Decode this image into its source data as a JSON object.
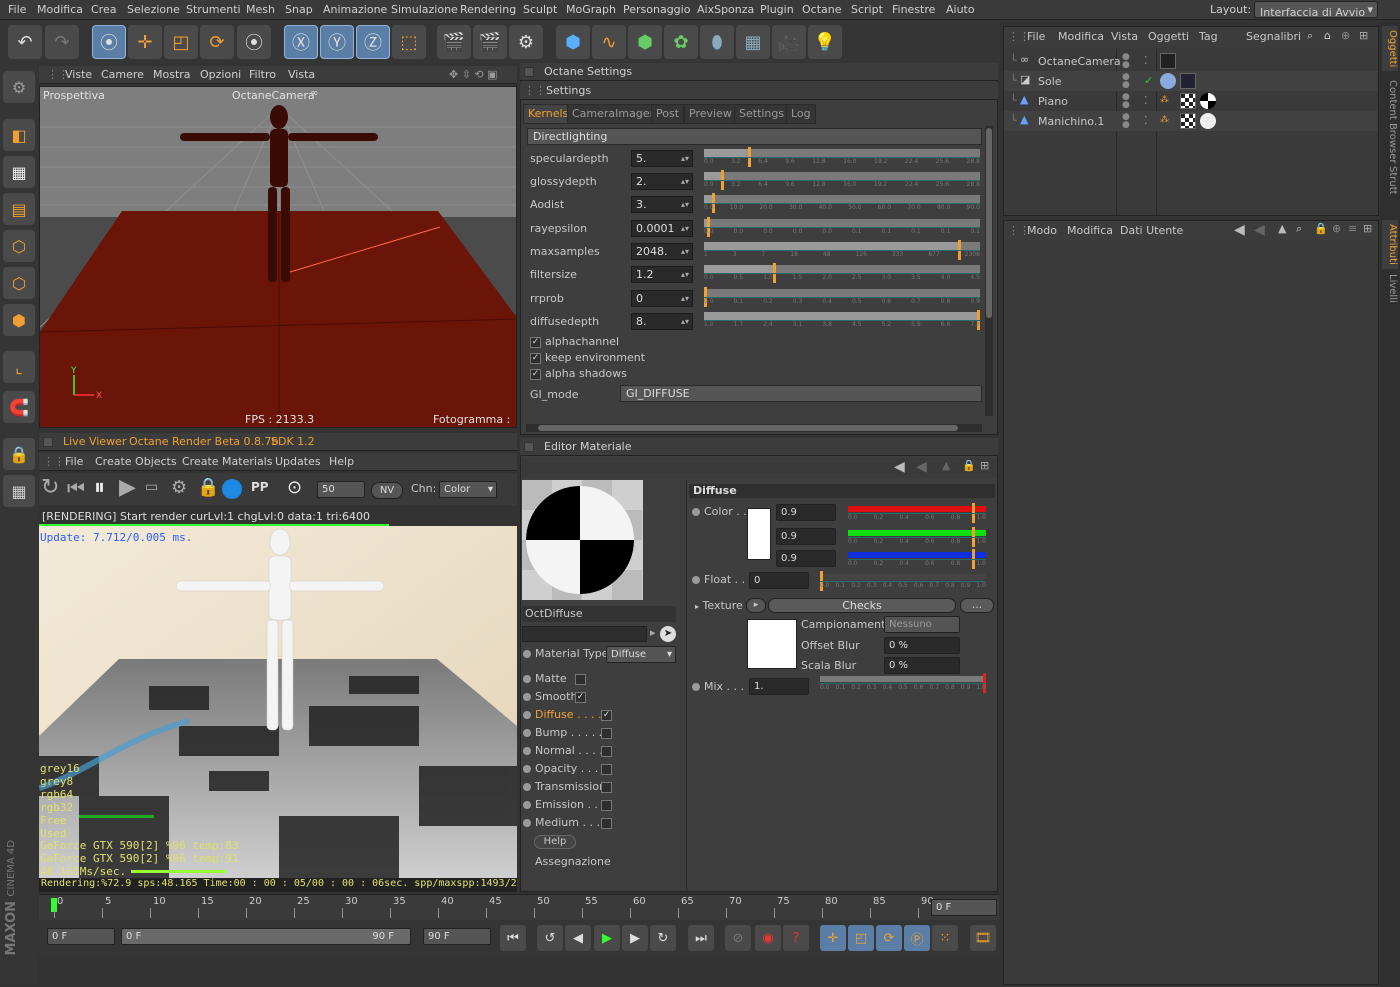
{
  "menu": [
    "File",
    "Modifica",
    "Crea",
    "Selezione",
    "Strumenti",
    "Mesh",
    "Snap",
    "Animazione",
    "Simulazione",
    "Rendering",
    "Sculpt",
    "MoGraph",
    "Personaggio",
    "AixSponza",
    "Plugin",
    "Octane",
    "Script",
    "Finestre",
    "Aiuto"
  ],
  "layout": {
    "label": "Layout:",
    "value": "Interfaccia di Avvio"
  },
  "viewport": {
    "menu": [
      "Viste",
      "Camere",
      "Mostra",
      "Opzioni",
      "Filtro",
      "Vista"
    ],
    "name": "Prospettiva",
    "camera": "OctaneCamera",
    "fps": "FPS : 2133.3",
    "frame": "Fotogramma : 0",
    "axis_y": "Y",
    "axis_x": "X"
  },
  "liveviewer": {
    "title": "Live Viewer",
    "version": "Octane Render Beta 0.8.7b",
    "sdk": "SDK 1.2",
    "menu": [
      "File",
      "Create Objects",
      "Create Materials",
      "Updates",
      "Help"
    ],
    "spp": "50",
    "nv": "NV",
    "chn_label": "Chn:",
    "chn_value": "Color",
    "status": "[RENDERING] Start render curLvl:1 chgLvl:0 data:1 tri:6400",
    "update": "Update: 7.712/0.005 ms.",
    "mem": [
      "grey16",
      "grey8",
      "rgb64",
      "rgb32",
      "Free",
      "Used"
    ],
    "gpu1": "GeForce GTX 590[2] %96 temp:83",
    "gpu2": "GeForce GTX 590[2] %96 temp:91",
    "speed": "48.165Ms/sec.",
    "footer": "Rendering:%72.9 sps:48.165 Time:00 : 00 : 05/00 : 00 : 06sec. spp/maxspp:1493/2048 Mem:5/1:"
  },
  "octane": {
    "title": "Octane Settings",
    "subtitle": "Settings",
    "tabs": [
      "Kernels",
      "CameraImager",
      "Post",
      "Preview",
      "Settings",
      "Log"
    ],
    "section": "Directlighting",
    "params": [
      {
        "label": "speculardepth",
        "value": "5.",
        "fill": 0.16,
        "ticks": [
          "0.0",
          "3.2",
          "6.4",
          "9.6",
          "12.8",
          "16.0",
          "19.2",
          "22.4",
          "25.6",
          "28.8"
        ]
      },
      {
        "label": "glossydepth",
        "value": "2.",
        "fill": 0.06,
        "ticks": [
          "0.0",
          "3.2",
          "6.4",
          "9.6",
          "12.8",
          "16.0",
          "19.2",
          "22.4",
          "25.6",
          "28.8"
        ]
      },
      {
        "label": "Aodist",
        "value": "3.",
        "fill": 0.03,
        "ticks": [
          "0.0",
          "10.0",
          "20.0",
          "30.0",
          "40.0",
          "50.0",
          "60.0",
          "70.0",
          "80.0",
          "90.0"
        ]
      },
      {
        "label": "rayepsilon",
        "value": "0.0001",
        "fill": 0.01,
        "ticks": [
          "0.0",
          "0.0",
          "0.0",
          "0.0",
          "0.0",
          "0.1",
          "0.1",
          "0.1",
          "0.1",
          "0.1"
        ]
      },
      {
        "label": "maxsamples",
        "value": "2048.",
        "fill": 0.92,
        "ticks": [
          "1",
          "3",
          "7",
          "18",
          "48",
          "126",
          "333",
          "877",
          "2308"
        ]
      },
      {
        "label": "filtersize",
        "value": "1.2",
        "fill": 0.25,
        "ticks": [
          "0.0",
          "0.5",
          "1.0",
          "1.5",
          "2.0",
          "2.5",
          "3.0",
          "3.5",
          "4.0",
          "4.5"
        ]
      },
      {
        "label": "rrprob",
        "value": "0",
        "fill": 0.0,
        "ticks": [
          "0.0",
          "0.1",
          "0.2",
          "0.3",
          "0.4",
          "0.5",
          "0.6",
          "0.7",
          "0.8",
          "0.9"
        ]
      },
      {
        "label": "diffusedepth",
        "value": "8.",
        "fill": 1.0,
        "ticks": [
          "1.0",
          "1.7",
          "2.4",
          "3.1",
          "3.8",
          "4.5",
          "5.2",
          "5.9",
          "6.6",
          "7.3"
        ]
      }
    ],
    "checks": [
      "alphachannel",
      "keep environment",
      "alpha shadows"
    ],
    "gi_label": "GI_mode",
    "gi_value": "GI_DIFFUSE"
  },
  "editor": {
    "title": "Editor Materiale",
    "material_name": "OctDiffuse",
    "material_type_label": "Material Type",
    "material_type": "Diffuse",
    "channels": [
      {
        "label": "Matte",
        "checked": false
      },
      {
        "label": "Smooth",
        "checked": true
      },
      {
        "label": "Diffuse . . . .",
        "checked": true,
        "active": true
      },
      {
        "label": "Bump . . . . . .",
        "checked": false
      },
      {
        "label": "Normal . . . . .",
        "checked": false
      },
      {
        "label": "Opacity . . . .",
        "checked": false
      },
      {
        "label": "Transmission",
        "checked": false
      },
      {
        "label": "Emission . . .",
        "checked": false
      },
      {
        "label": "Medium . . . .",
        "checked": false
      }
    ],
    "help": "Help",
    "assign": "Assegnazione",
    "diffuse_title": "Diffuse",
    "color_label": "Color . .",
    "rgb": [
      "0.9",
      "0.9",
      "0.9"
    ],
    "float_label": "Float . .",
    "float_value": "0",
    "texture_label": "Texture",
    "texture_name": "Checks",
    "more": "...",
    "sampling_label": "Campionamento",
    "sampling_value": "Nessuno",
    "blur_offset_label": "Offset Blur",
    "blur_offset": "0 %",
    "blur_scale_label": "Scala Blur",
    "blur_scale": "0 %",
    "mix_label": "Mix . . .",
    "mix_value": "1.",
    "unit_ticks": [
      "0.0",
      "0.2",
      "0.4",
      "0.6",
      "0.8",
      "1.0"
    ],
    "dec_ticks": [
      "0.0",
      "0.1",
      "0.2",
      "0.3",
      "0.4",
      "0.5",
      "0.6",
      "0.7",
      "0.8",
      "0.9",
      "1.0"
    ]
  },
  "objects": {
    "menu": [
      "File",
      "Modifica",
      "Vista",
      "Oggetti",
      "Tag",
      "Segnalibri"
    ],
    "items": [
      {
        "name": "OctaneCamera",
        "icon": "camera-icon"
      },
      {
        "name": "Sole",
        "icon": "light-icon"
      },
      {
        "name": "Piano",
        "icon": "plane-icon"
      },
      {
        "name": "Manichino.1",
        "icon": "figure-icon"
      }
    ]
  },
  "attributes": {
    "menu": [
      "Modo",
      "Modifica",
      "Dati Utente"
    ]
  },
  "vtabs": [
    "Oggetti",
    "Content Browser",
    "Strutt",
    "Attributi",
    "Livelli"
  ],
  "timeline": {
    "ticks": [
      "0",
      "5",
      "10",
      "15",
      "20",
      "25",
      "30",
      "35",
      "40",
      "45",
      "50",
      "55",
      "60",
      "65",
      "70",
      "75",
      "80",
      "85",
      "90"
    ],
    "current": "0 F",
    "start": "0 F",
    "range_start": "0 F",
    "range_end": "90 F",
    "end": "90 F"
  },
  "brand": {
    "line1": "MAXON",
    "line2": "CINEMA 4D"
  },
  "colors": {
    "accent": "#f0a030",
    "render_text": "#e0e06a",
    "update_text": "#2c5cff"
  }
}
